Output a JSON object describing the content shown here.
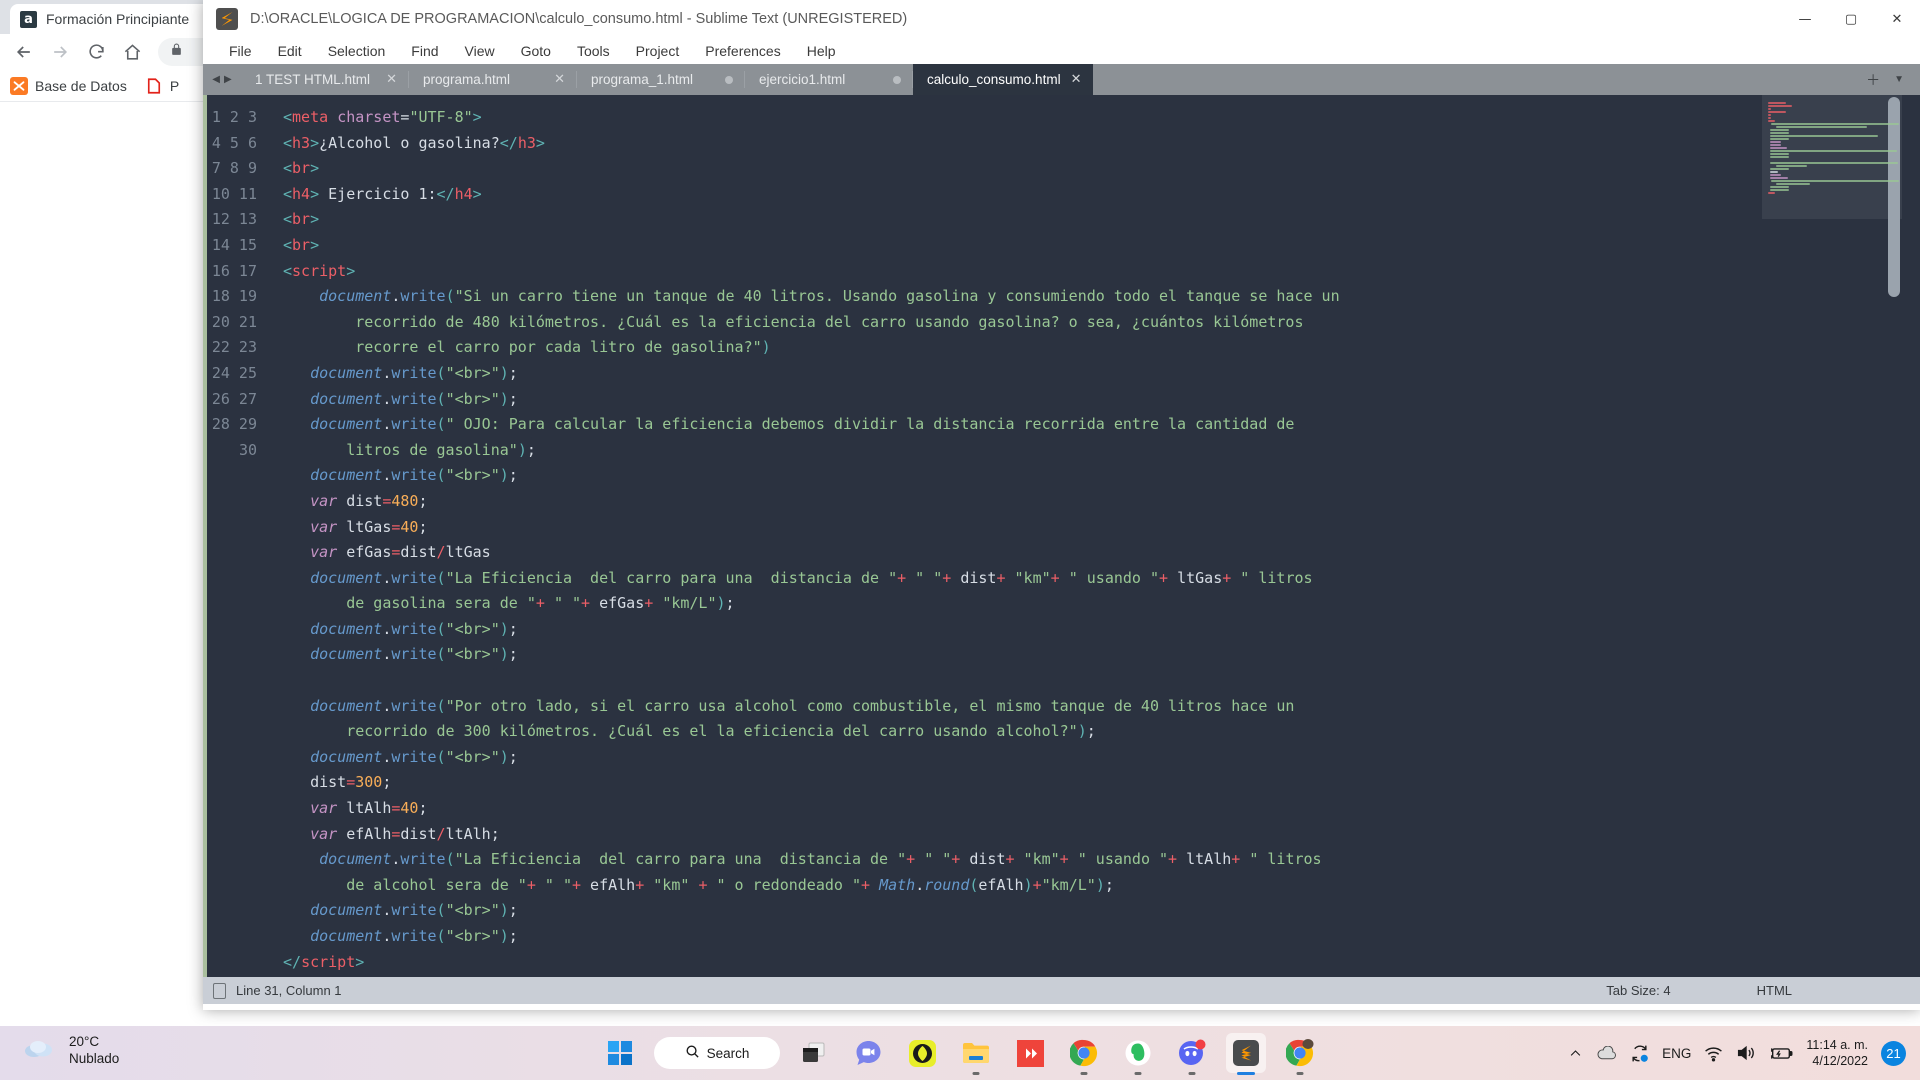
{
  "browser": {
    "tab_title": "Formación Principiante",
    "tab_favicon": "a",
    "back_icon": "back-arrow-icon",
    "forward_icon": "forward-arrow-icon",
    "reload_icon": "reload-icon",
    "home_icon": "home-icon",
    "lock_icon": "lock-icon",
    "bookmarks": [
      {
        "label": "Base de Datos",
        "icon": "xampp-icon"
      },
      {
        "label": "P",
        "icon": "pdf-icon"
      }
    ],
    "menu_icon": "more-vertical-icon"
  },
  "sublime": {
    "title": "D:\\ORACLE\\LOGICA DE PROGRAMACION\\calculo_consumo.html - Sublime Text (UNREGISTERED)",
    "logo_icon": "sublime-text-icon",
    "window_controls": [
      {
        "name": "minimize-button",
        "glyph": "—"
      },
      {
        "name": "maximize-button",
        "glyph": "▢"
      },
      {
        "name": "close-button",
        "glyph": "✕"
      }
    ],
    "menu": [
      "File",
      "Edit",
      "Selection",
      "Find",
      "View",
      "Goto",
      "Tools",
      "Project",
      "Preferences",
      "Help"
    ],
    "tabs": [
      {
        "label": "1 TEST HTML.html",
        "active": false,
        "dirty": false
      },
      {
        "label": "programa.html",
        "active": false,
        "dirty": false
      },
      {
        "label": "programa_1.html",
        "active": false,
        "dirty": true
      },
      {
        "label": "ejercicio1.html",
        "active": false,
        "dirty": true
      },
      {
        "label": "calculo_consumo.html",
        "active": true,
        "dirty": false
      }
    ],
    "tab_new_icon": "plus-icon",
    "tab_menu_icon": "chevron-down-icon",
    "status": {
      "cursor": "Line 31, Column 1",
      "tab_size": "Tab Size: 4",
      "syntax": "HTML",
      "encoding_icon": "file-icon"
    },
    "code_lines": [
      {
        "n": "1"
      },
      {
        "n": "2"
      },
      {
        "n": "3"
      },
      {
        "n": "4"
      },
      {
        "n": "5"
      },
      {
        "n": "6"
      },
      {
        "n": "7"
      },
      {
        "n": "8"
      },
      {
        "n": ""
      },
      {
        "n": ""
      },
      {
        "n": "9"
      },
      {
        "n": "10"
      },
      {
        "n": "11"
      },
      {
        "n": ""
      },
      {
        "n": "12"
      },
      {
        "n": "13"
      },
      {
        "n": "14"
      },
      {
        "n": "15"
      },
      {
        "n": "16"
      },
      {
        "n": ""
      },
      {
        "n": "17"
      },
      {
        "n": "18"
      },
      {
        "n": "19"
      },
      {
        "n": "20"
      },
      {
        "n": ""
      },
      {
        "n": "21"
      },
      {
        "n": "22"
      },
      {
        "n": "23"
      },
      {
        "n": "24"
      },
      {
        "n": "25"
      },
      {
        "n": ""
      },
      {
        "n": "26"
      },
      {
        "n": "27"
      },
      {
        "n": "28"
      },
      {
        "n": "29"
      },
      {
        "n": "30"
      }
    ],
    "code_text": [
      "<meta charset=\"UTF-8\">",
      "<h3>¿Alcohol o gasolina?</h3>",
      "<br>",
      "<h4> Ejercicio 1:</h4>",
      "<br>",
      "<br>",
      "<script>",
      "    document.write(\"Si un carro tiene un tanque de 40 litros. Usando gasolina y consumiendo todo el tanque se hace un recorrido de 480 kilómetros. ¿Cuál es la eficiencia del carro usando gasolina? o sea, ¿cuántos kilómetros recorre el carro por cada litro de gasolina?\")",
      "   document.write(\"<br>\");",
      "   document.write(\"<br>\");",
      "   document.write(\" OJO: Para calcular la eficiencia debemos dividir la distancia recorrida entre la cantidad de litros de gasolina\");",
      "   document.write(\"<br>\");",
      "   var dist=480;",
      "   var ltGas=40;",
      "   var efGas=dist/ltGas",
      "   document.write(\"La Eficiencia  del carro para una  distancia de \"+ \" \"+ dist+ \"km\"+ \" usando \"+ ltGas+ \" litros de gasolina sera de \"+ \" \"+ efGas+ \"km/L\");",
      "   document.write(\"<br>\");",
      "   document.write(\"<br>\");",
      "",
      "   document.write(\"Por otro lado, si el carro usa alcohol como combustible, el mismo tanque de 40 litros hace un recorrido de 300 kilómetros. ¿Cuál es el la eficiencia del carro usando alcohol?\");",
      "   document.write(\"<br>\");",
      "   dist=300;",
      "   var ltAlh=40;",
      "   var efAlh=dist/ltAlh;",
      "    document.write(\"La Eficiencia  del carro para una  distancia de \"+ \" \"+ dist+ \"km\"+ \" usando \"+ ltAlh+ \" litros de alcohol sera de \"+ \" \"+ efAlh+ \"km\" + \" o redondeado \"+ Math.round(efAlh)+\"km/L\");",
      "   document.write(\"<br>\");",
      "   document.write(\"<br>\");",
      "</script>",
      "",
      ""
    ],
    "colors": {
      "background": "#2b3240",
      "tag": "#ec5f67",
      "bracket": "#5fb3b3",
      "attribute": "#c594c5",
      "string": "#99c794",
      "function": "#6699cc",
      "number": "#f9ae58",
      "plain": "#d7dde5",
      "gutter": "#7c8795",
      "tabbar": "#8c9196",
      "active_tab": "#2c3440",
      "statusbar": "#c9ced6",
      "left_rail": "#aabf9e"
    }
  },
  "taskbar": {
    "weather": {
      "temp": "20°C",
      "condition": "Nublado",
      "icon": "cloud-icon"
    },
    "start_icon": "windows-start-icon",
    "search_label": "Search",
    "search_icon": "search-icon",
    "apps": [
      {
        "name": "task-view",
        "icon": "task-view-icon",
        "running": false,
        "active": false
      },
      {
        "name": "chat",
        "icon": "chat-teams-icon",
        "running": false,
        "active": false
      },
      {
        "name": "xbox",
        "icon": "xbox-icon",
        "running": false,
        "active": false
      },
      {
        "name": "file-explorer",
        "icon": "file-explorer-icon",
        "running": true,
        "active": false
      },
      {
        "name": "anydesk",
        "icon": "anydesk-icon",
        "running": false,
        "active": false
      },
      {
        "name": "chrome",
        "icon": "chrome-icon",
        "running": true,
        "active": false
      },
      {
        "name": "evernote",
        "icon": "evernote-icon",
        "running": true,
        "active": false
      },
      {
        "name": "discord",
        "icon": "discord-icon",
        "running": true,
        "active": false
      },
      {
        "name": "sublime-text",
        "icon": "sublime-text-icon",
        "running": true,
        "active": true
      },
      {
        "name": "chrome-window",
        "icon": "chrome-icon",
        "running": true,
        "active": false
      }
    ],
    "tray": {
      "overflow_icon": "chevron-up-icon",
      "onedrive_icon": "onedrive-icon",
      "sync_icon": "sync-icon",
      "language": "ENG",
      "wifi_icon": "wifi-icon",
      "volume_icon": "volume-icon",
      "battery_icon": "battery-charging-icon",
      "time": "11:14 a. m.",
      "date": "4/12/2022",
      "notification_count": "21"
    }
  }
}
